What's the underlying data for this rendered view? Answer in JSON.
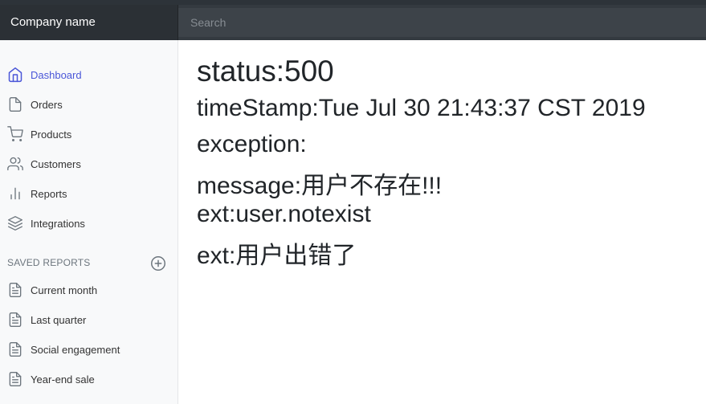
{
  "header": {
    "brand": "Company name",
    "search_placeholder": "Search"
  },
  "sidebar": {
    "items": [
      {
        "label": "Dashboard",
        "icon": "home-icon"
      },
      {
        "label": "Orders",
        "icon": "file-icon"
      },
      {
        "label": "Products",
        "icon": "shopping-cart-icon"
      },
      {
        "label": "Customers",
        "icon": "users-icon"
      },
      {
        "label": "Reports",
        "icon": "bar-chart-icon"
      },
      {
        "label": "Integrations",
        "icon": "layers-icon"
      }
    ],
    "saved_reports_heading": "SAVED REPORTS",
    "saved_reports": [
      {
        "label": "Current month",
        "icon": "file-text-icon"
      },
      {
        "label": "Last quarter",
        "icon": "file-text-icon"
      },
      {
        "label": "Social engagement",
        "icon": "file-text-icon"
      },
      {
        "label": "Year-end sale",
        "icon": "file-text-icon"
      }
    ]
  },
  "content": {
    "status": "status:500",
    "timestamp": "timeStamp:Tue Jul 30 21:43:37 CST 2019",
    "exception": "exception:",
    "message": "message:用户不存在!!!",
    "ext1": "ext:user.notexist",
    "ext2": "ext:用户出错了"
  },
  "colors": {
    "navbar": "#343a40",
    "sidebar_bg": "#f8f9fa",
    "active": "#4a56d8"
  }
}
